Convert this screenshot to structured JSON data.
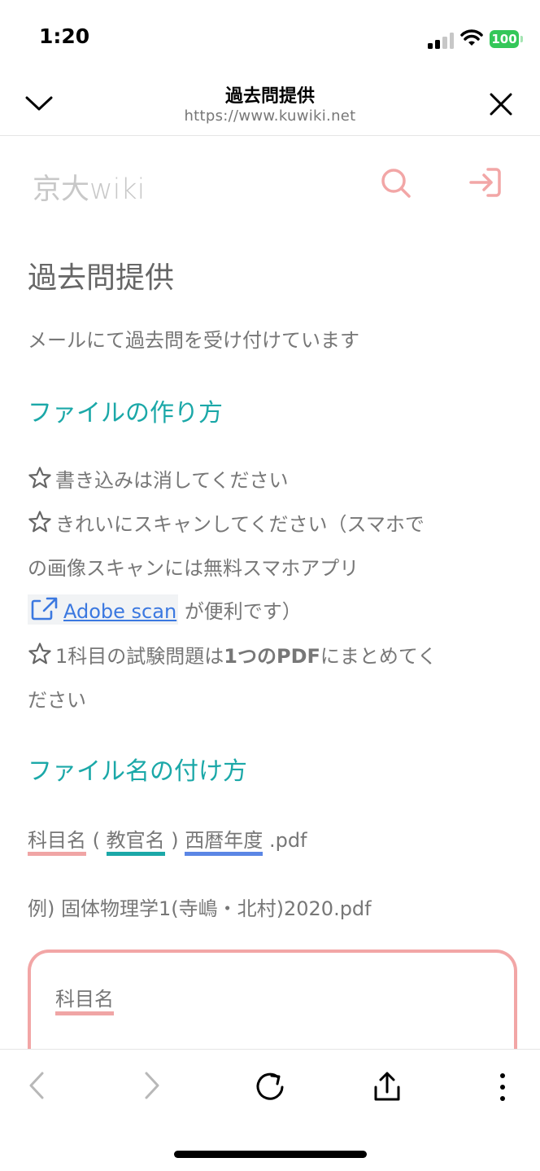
{
  "status": {
    "time": "1:20",
    "battery": "100"
  },
  "browser": {
    "title": "過去問提供",
    "url": "https://www.kuwiki.net"
  },
  "site": {
    "logo": "京大wiki"
  },
  "page": {
    "title": "過去問提供",
    "intro": "メールにて過去問を受け付けています",
    "section1": {
      "heading": "ファイルの作り方",
      "item1": "書き込みは消してください",
      "item2a": "きれいにスキャンしてください（スマホで",
      "item2b": "の画像スキャンには無料スマホアプリ",
      "link": "Adobe scan",
      "item2c": "が便利です）",
      "item3a_pre": "1科目の試験問題は",
      "item3a_bold": "1つのPDF",
      "item3a_post": "にまとめてく",
      "item3b": "ださい"
    },
    "section2": {
      "heading": "ファイル名の付け方",
      "part_subject": "科目名",
      "open_paren": "(",
      "part_teacher": "教官名",
      "close_paren": ")",
      "part_year": "西暦年度",
      "ext": ".pdf",
      "example": "例) 固体物理学1(寺嶋・北村)2020.pdf",
      "box_label": "科目名"
    }
  },
  "colors": {
    "teal": "#1ba8a8",
    "pink": "#f0a5a5",
    "blue": "#5b86e5",
    "link": "#3b78e0",
    "battery": "#34c759"
  }
}
